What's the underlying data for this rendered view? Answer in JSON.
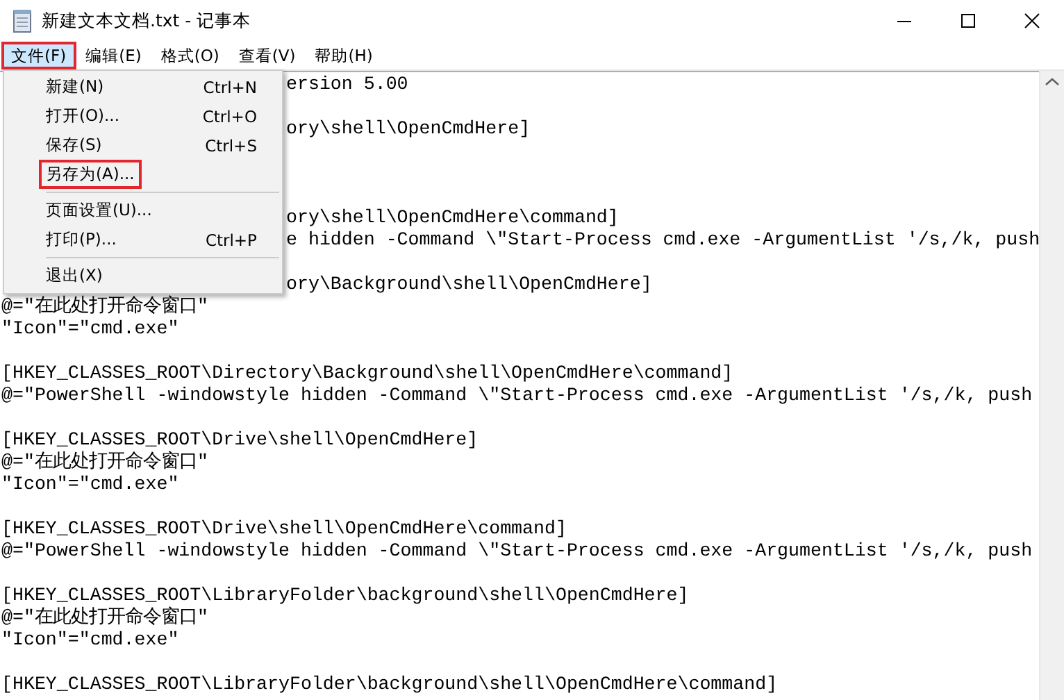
{
  "window": {
    "title": "新建文本文档.txt - 记事本"
  },
  "menubar": [
    {
      "label": "文件(F)",
      "selected": true,
      "highlighted": true
    },
    {
      "label": "编辑(E)",
      "selected": false,
      "highlighted": false
    },
    {
      "label": "格式(O)",
      "selected": false,
      "highlighted": false
    },
    {
      "label": "查看(V)",
      "selected": false,
      "highlighted": false
    },
    {
      "label": "帮助(H)",
      "selected": false,
      "highlighted": false
    }
  ],
  "file_menu": [
    {
      "kind": "item",
      "label": "新建(N)",
      "shortcut": "Ctrl+N",
      "highlighted": false
    },
    {
      "kind": "item",
      "label": "打开(O)...",
      "shortcut": "Ctrl+O",
      "highlighted": false
    },
    {
      "kind": "item",
      "label": "保存(S)",
      "shortcut": "Ctrl+S",
      "highlighted": false
    },
    {
      "kind": "item",
      "label": "另存为(A)...",
      "highlighted": true
    },
    {
      "kind": "separator"
    },
    {
      "kind": "item",
      "label": "页面设置(U)...",
      "highlighted": false
    },
    {
      "kind": "item",
      "label": "打印(P)...",
      "shortcut": "Ctrl+P",
      "highlighted": false
    },
    {
      "kind": "separator"
    },
    {
      "kind": "item",
      "label": "退出(X)",
      "highlighted": false
    }
  ],
  "editor_lines": [
    {
      "kind": "covered",
      "text": "ersion 5.00"
    },
    {
      "kind": "blank"
    },
    {
      "kind": "covered",
      "text": "ory\\shell\\OpenCmdHere]"
    },
    {
      "kind": "hidden"
    },
    {
      "kind": "hidden"
    },
    {
      "kind": "blank"
    },
    {
      "kind": "covered",
      "text": "ory\\shell\\OpenCmdHere\\command]"
    },
    {
      "kind": "covered",
      "text": "e hidden -Command \\\"Start-Process cmd.exe -ArgumentList '/s,/k, push"
    },
    {
      "kind": "blank"
    },
    {
      "kind": "covered",
      "text": "ory\\Background\\shell\\OpenCmdHere]"
    },
    {
      "kind": "text",
      "text": "@=\"在此处打开命令窗口\""
    },
    {
      "kind": "text",
      "text": "\"Icon\"=\"cmd.exe\""
    },
    {
      "kind": "blank"
    },
    {
      "kind": "text",
      "text": "[HKEY_CLASSES_ROOT\\Directory\\Background\\shell\\OpenCmdHere\\command]"
    },
    {
      "kind": "text",
      "text": "@=\"PowerShell -windowstyle hidden -Command \\\"Start-Process cmd.exe -ArgumentList '/s,/k, push"
    },
    {
      "kind": "blank"
    },
    {
      "kind": "text",
      "text": "[HKEY_CLASSES_ROOT\\Drive\\shell\\OpenCmdHere]"
    },
    {
      "kind": "text",
      "text": "@=\"在此处打开命令窗口\""
    },
    {
      "kind": "text",
      "text": "\"Icon\"=\"cmd.exe\""
    },
    {
      "kind": "blank"
    },
    {
      "kind": "text",
      "text": "[HKEY_CLASSES_ROOT\\Drive\\shell\\OpenCmdHere\\command]"
    },
    {
      "kind": "text",
      "text": "@=\"PowerShell -windowstyle hidden -Command \\\"Start-Process cmd.exe -ArgumentList '/s,/k, push"
    },
    {
      "kind": "blank"
    },
    {
      "kind": "text",
      "text": "[HKEY_CLASSES_ROOT\\LibraryFolder\\background\\shell\\OpenCmdHere]"
    },
    {
      "kind": "text",
      "text": "@=\"在此处打开命令窗口\""
    },
    {
      "kind": "text",
      "text": "\"Icon\"=\"cmd.exe\""
    },
    {
      "kind": "blank"
    },
    {
      "kind": "text",
      "text": "[HKEY_CLASSES_ROOT\\LibraryFolder\\background\\shell\\OpenCmdHere\\command]"
    }
  ]
}
